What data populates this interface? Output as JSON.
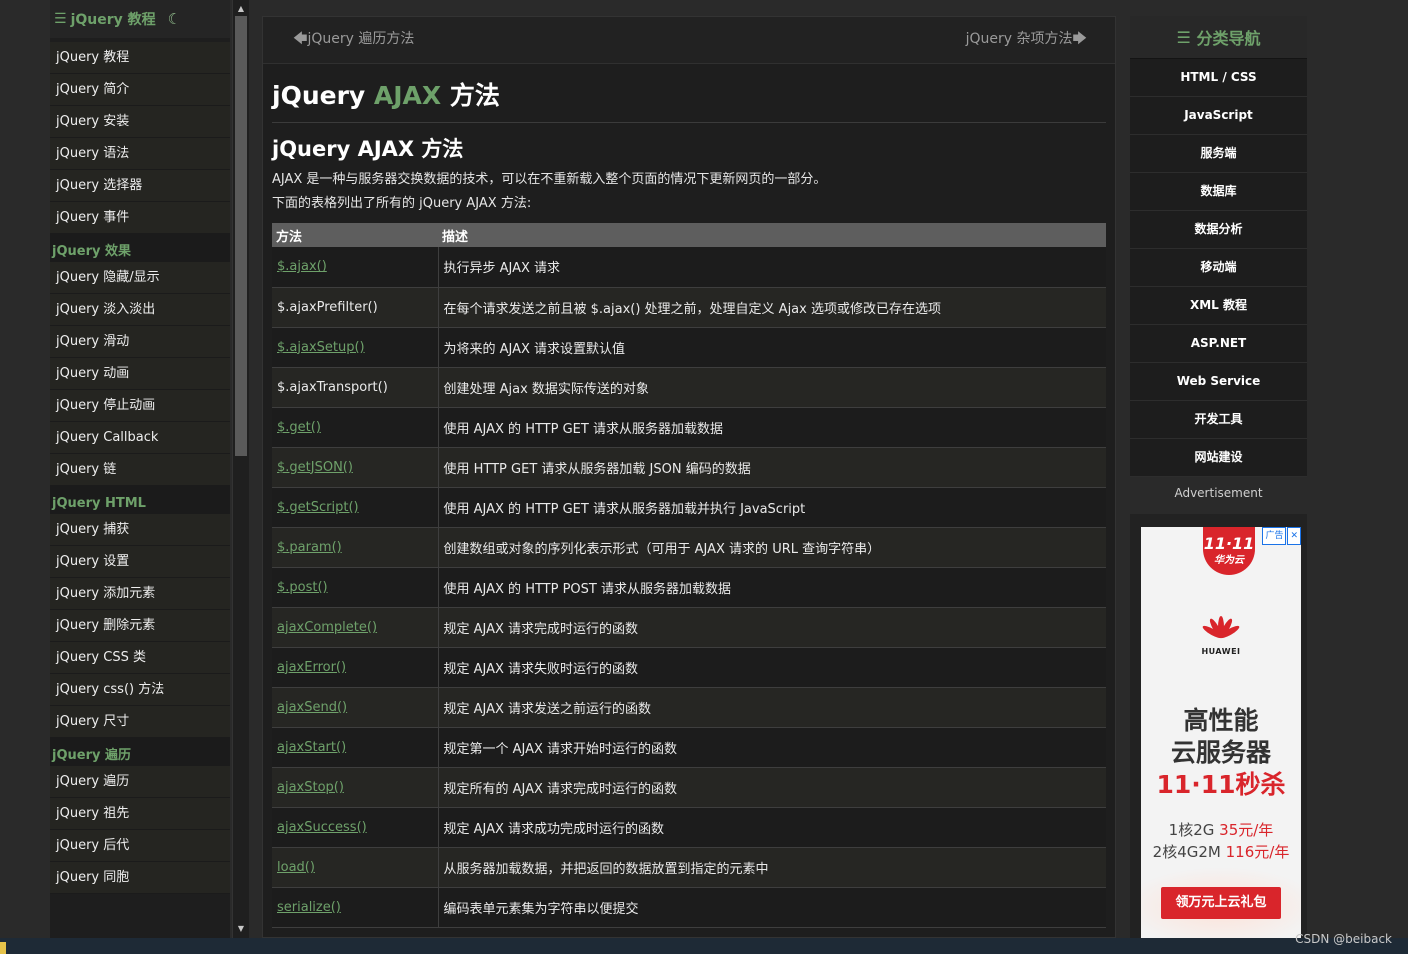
{
  "sidebar": {
    "header": "jQuery 教程",
    "header_icon": "list-icon",
    "theme_icon": "moon-icon",
    "groups": [
      {
        "title": "",
        "items": [
          "jQuery 教程",
          "jQuery 简介",
          "jQuery 安装",
          "jQuery 语法",
          "jQuery 选择器",
          "jQuery 事件"
        ]
      },
      {
        "title": "jQuery 效果",
        "items": [
          "jQuery 隐藏/显示",
          "jQuery 淡入淡出",
          "jQuery 滑动",
          "jQuery 动画",
          "jQuery 停止动画",
          "jQuery Callback",
          "jQuery 链"
        ]
      },
      {
        "title": "jQuery HTML",
        "items": [
          "jQuery 捕获",
          "jQuery 设置",
          "jQuery 添加元素",
          "jQuery 删除元素",
          "jQuery CSS 类",
          "jQuery css() 方法",
          "jQuery 尺寸"
        ]
      },
      {
        "title": "jQuery 遍历",
        "items": [
          "jQuery 遍历",
          "jQuery 祖先",
          "jQuery 后代",
          "jQuery 同胞"
        ]
      }
    ]
  },
  "pager": {
    "prev": "jQuery 遍历方法",
    "next": "jQuery 杂项方法"
  },
  "page": {
    "title_prefix": "jQuery ",
    "title_highlight": "AJAX",
    "title_suffix": " 方法",
    "section_title": "jQuery AJAX 方法",
    "intro": "AJAX 是一种与服务器交换数据的技术，可以在不重新载入整个页面的情况下更新网页的一部分。",
    "intro2": "下面的表格列出了所有的 jQuery AJAX 方法:"
  },
  "table": {
    "headers": [
      "方法",
      "描述"
    ],
    "rows": [
      {
        "method": "$.ajax()",
        "link": true,
        "desc": "执行异步 AJAX 请求"
      },
      {
        "method": "$.ajaxPrefilter()",
        "link": false,
        "desc": "在每个请求发送之前且被 $.ajax() 处理之前，处理自定义 Ajax 选项或修改已存在选项"
      },
      {
        "method": "$.ajaxSetup()",
        "link": true,
        "desc": "为将来的 AJAX 请求设置默认值"
      },
      {
        "method": "$.ajaxTransport()",
        "link": false,
        "desc": "创建处理 Ajax 数据实际传送的对象"
      },
      {
        "method": "$.get()",
        "link": true,
        "desc": "使用 AJAX 的 HTTP GET 请求从服务器加载数据"
      },
      {
        "method": "$.getJSON()",
        "link": true,
        "desc": "使用 HTTP GET 请求从服务器加载 JSON 编码的数据"
      },
      {
        "method": "$.getScript()",
        "link": true,
        "desc": "使用 AJAX 的 HTTP GET 请求从服务器加载并执行 JavaScript"
      },
      {
        "method": "$.param()",
        "link": true,
        "desc": "创建数组或对象的序列化表示形式（可用于 AJAX 请求的 URL 查询字符串）"
      },
      {
        "method": "$.post()",
        "link": true,
        "desc": "使用 AJAX 的 HTTP POST 请求从服务器加载数据"
      },
      {
        "method": "ajaxComplete()",
        "link": true,
        "desc": "规定 AJAX 请求完成时运行的函数"
      },
      {
        "method": "ajaxError()",
        "link": true,
        "desc": "规定 AJAX 请求失败时运行的函数"
      },
      {
        "method": "ajaxSend()",
        "link": true,
        "desc": "规定 AJAX 请求发送之前运行的函数"
      },
      {
        "method": "ajaxStart()",
        "link": true,
        "desc": "规定第一个 AJAX 请求开始时运行的函数"
      },
      {
        "method": "ajaxStop()",
        "link": true,
        "desc": "规定所有的 AJAX 请求完成时运行的函数"
      },
      {
        "method": "ajaxSuccess()",
        "link": true,
        "desc": "规定 AJAX 请求成功完成时运行的函数"
      },
      {
        "method": "load()",
        "link": true,
        "desc": "从服务器加载数据，并把返回的数据放置到指定的元素中"
      },
      {
        "method": "serialize()",
        "link": true,
        "desc": "编码表单元素集为字符串以便提交"
      }
    ]
  },
  "right_nav": {
    "title": "分类导航",
    "items": [
      "HTML / CSS",
      "JavaScript",
      "服务端",
      "数据库",
      "数据分析",
      "移动端",
      "XML 教程",
      "ASP.NET",
      "Web Service",
      "开发工具",
      "网站建设"
    ]
  },
  "ad": {
    "label": "Advertisement",
    "badge_line1": "11·11",
    "badge_line2": "华为云",
    "ad_tag": "广告",
    "close": "✕",
    "brand": "HUAWEI",
    "headline1": "高性能",
    "headline2": "云服务器",
    "headline3": "11·11秒杀",
    "price1_prefix": "1核2G ",
    "price1_value": "35元/年",
    "price2_prefix": "2核4G2M ",
    "price2_value": "116元/年",
    "button": "领万元上云礼包"
  },
  "watermark": "CSDN @beiback",
  "colors": {
    "accent": "#6ea16a",
    "background": "#2a2a2a",
    "ad_red": "#d9252b"
  }
}
